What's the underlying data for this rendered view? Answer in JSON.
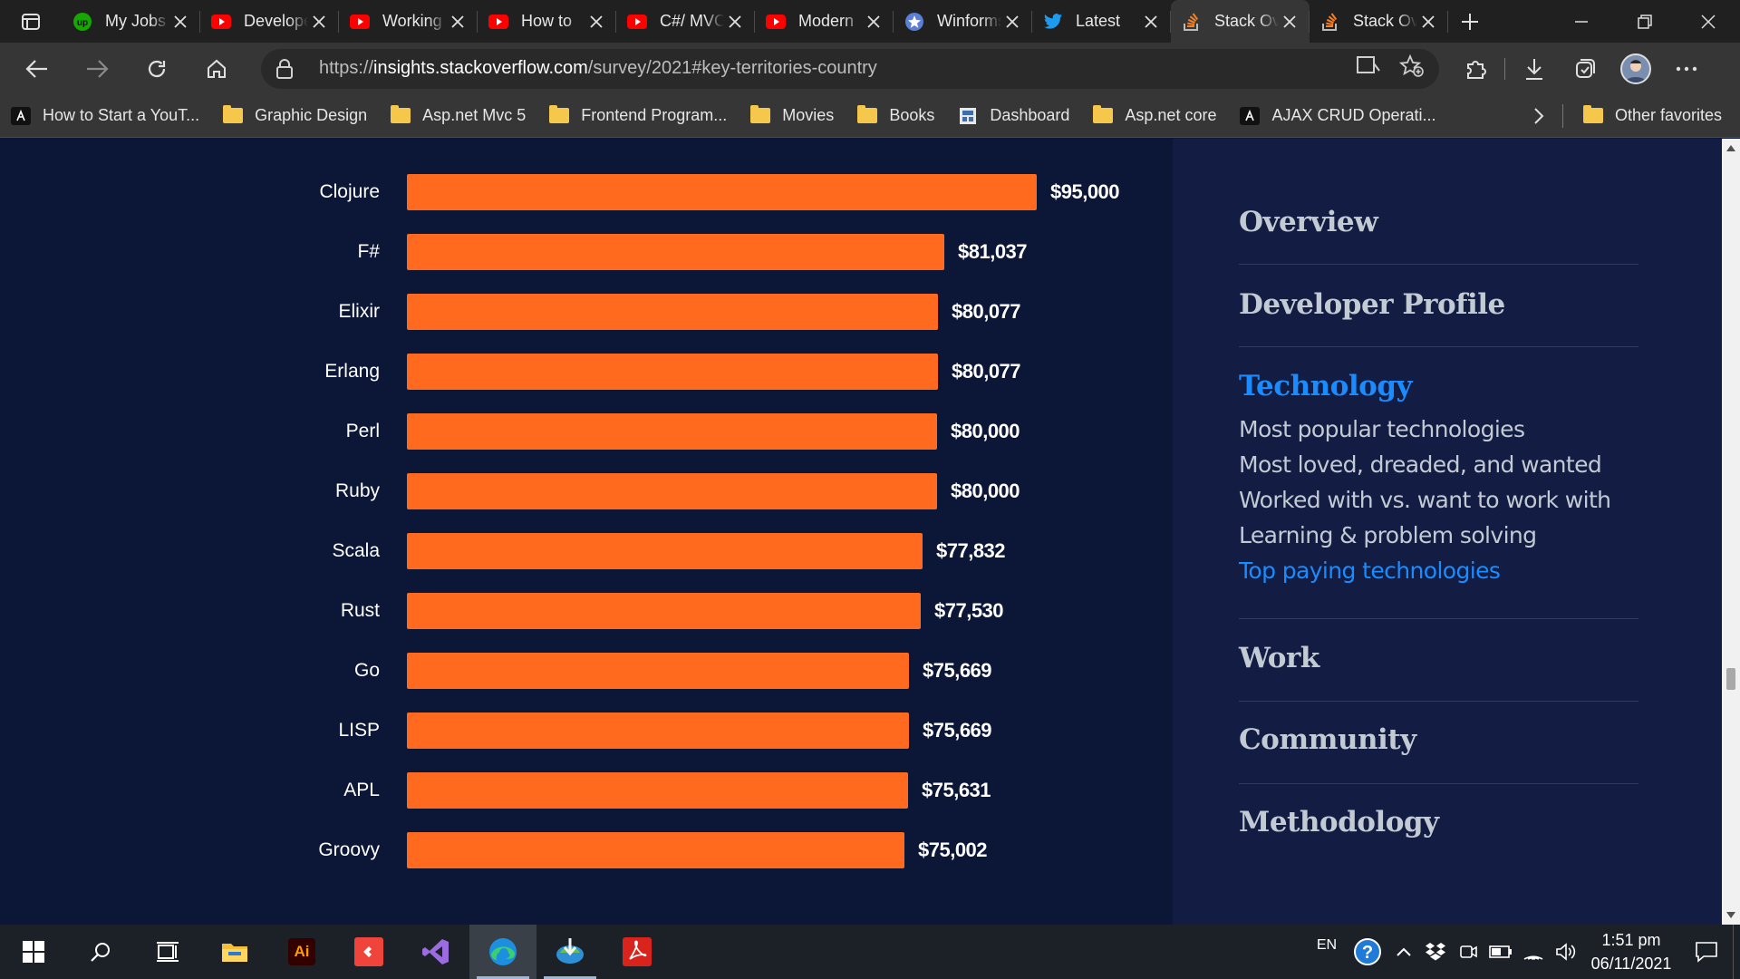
{
  "browser": {
    "tabs": [
      {
        "title": "My Jobs",
        "icon": "upwork-icon",
        "icon_color": "#14a800",
        "active": false
      },
      {
        "title": "Developer",
        "icon": "youtube-icon",
        "icon_color": "#ff0000",
        "active": false
      },
      {
        "title": "Working",
        "icon": "youtube-icon",
        "icon_color": "#ff0000",
        "active": false
      },
      {
        "title": "How to",
        "icon": "youtube-icon",
        "icon_color": "#ff0000",
        "active": false
      },
      {
        "title": "C#/ MVC",
        "icon": "youtube-icon",
        "icon_color": "#ff0000",
        "active": false
      },
      {
        "title": "Modern",
        "icon": "youtube-icon",
        "icon_color": "#ff0000",
        "active": false
      },
      {
        "title": "Winforms",
        "icon": "star-badge-icon",
        "icon_color": "#5a7fd6",
        "active": false
      },
      {
        "title": "Latest",
        "icon": "twitter-icon",
        "icon_color": "#1d9bf0",
        "active": false
      },
      {
        "title": "Stack Overflow",
        "icon": "stackoverflow-icon",
        "icon_color": "#f48024",
        "active": true
      },
      {
        "title": "Stack Overflow",
        "icon": "stackoverflow-icon",
        "icon_color": "#f48024",
        "active": false
      }
    ],
    "url_prefix": "https://",
    "url_host": "insights.stackoverflow.com",
    "url_path": "/survey/2021#key-territories-country",
    "favorites": [
      {
        "label": "How to Start a YouT...",
        "icon": "site-icon"
      },
      {
        "label": "Graphic Design",
        "icon": "folder-icon"
      },
      {
        "label": "Asp.net Mvc 5",
        "icon": "folder-icon"
      },
      {
        "label": "Frontend Program...",
        "icon": "folder-icon"
      },
      {
        "label": "Movies",
        "icon": "folder-icon"
      },
      {
        "label": "Books",
        "icon": "folder-icon"
      },
      {
        "label": "Dashboard",
        "icon": "dashboard-icon"
      },
      {
        "label": "Asp.net core",
        "icon": "folder-icon"
      },
      {
        "label": "AJAX CRUD Operati...",
        "icon": "site-icon"
      }
    ],
    "other_favorites": "Other favorites"
  },
  "chart_data": {
    "type": "bar",
    "orientation": "horizontal",
    "title": "",
    "categories": [
      "Clojure",
      "F#",
      "Elixir",
      "Erlang",
      "Perl",
      "Ruby",
      "Scala",
      "Rust",
      "Go",
      "LISP",
      "APL",
      "Groovy"
    ],
    "values": [
      95000,
      81037,
      80077,
      80077,
      80000,
      80000,
      77832,
      77530,
      75669,
      75669,
      75631,
      75002
    ],
    "value_labels": [
      "$95,000",
      "$81,037",
      "$80,077",
      "$80,077",
      "$80,000",
      "$80,000",
      "$77,832",
      "$77,530",
      "$75,669",
      "$75,669",
      "$75,631",
      "$75,002"
    ],
    "bar_color": "#ff6a1f",
    "xlim": [
      0,
      95000
    ],
    "grid": false,
    "legend": "none"
  },
  "sidebar": {
    "sections": [
      {
        "title": "Overview",
        "active": false,
        "items": []
      },
      {
        "title": "Developer Profile",
        "active": false,
        "items": []
      },
      {
        "title": "Technology",
        "active": true,
        "items": [
          {
            "label": "Most popular technologies",
            "active": false
          },
          {
            "label": "Most loved, dreaded, and wanted",
            "active": false
          },
          {
            "label": "Worked with vs. want to work with",
            "active": false
          },
          {
            "label": "Learning & problem solving",
            "active": false
          },
          {
            "label": "Top paying technologies",
            "active": true
          }
        ]
      },
      {
        "title": "Work",
        "active": false,
        "items": []
      },
      {
        "title": "Community",
        "active": false,
        "items": []
      },
      {
        "title": "Methodology",
        "active": false,
        "items": []
      }
    ],
    "accent_color": "#1a8cff"
  },
  "taskbar": {
    "apps": [
      {
        "name": "search-icon"
      },
      {
        "name": "task-view-icon"
      },
      {
        "name": "file-explorer-icon"
      },
      {
        "name": "illustrator-icon",
        "label": "Ai"
      },
      {
        "name": "anydesk-icon"
      },
      {
        "name": "visual-studio-icon"
      },
      {
        "name": "edge-icon"
      },
      {
        "name": "internet-download-manager-icon"
      },
      {
        "name": "acrobat-icon"
      }
    ],
    "language": "EN",
    "time": "1:51 pm",
    "date": "06/11/2021"
  }
}
